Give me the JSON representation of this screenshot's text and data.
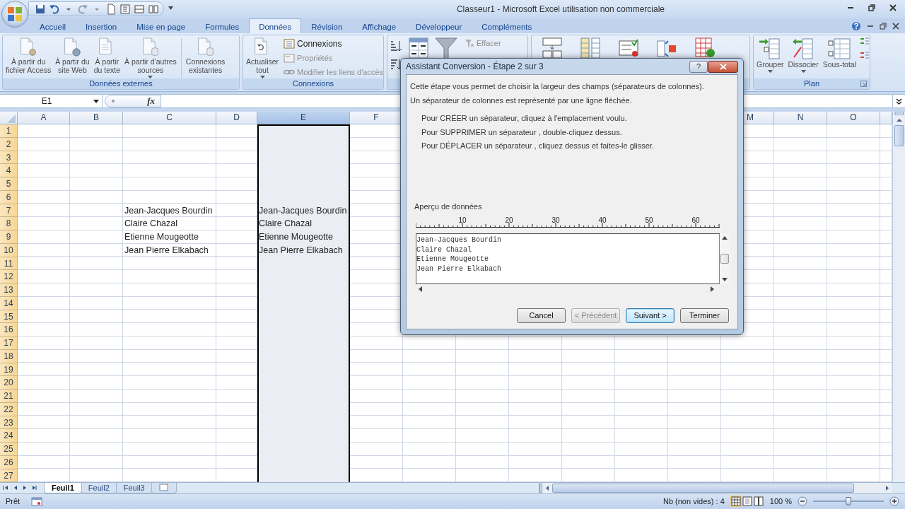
{
  "title_bar": {
    "title": "Classeur1 - Microsoft Excel utilisation non commerciale"
  },
  "ribbon": {
    "tabs": [
      {
        "label": "Accueil",
        "selected": false
      },
      {
        "label": "Insertion",
        "selected": false
      },
      {
        "label": "Mise en page",
        "selected": false
      },
      {
        "label": "Formules",
        "selected": false
      },
      {
        "label": "Données",
        "selected": true
      },
      {
        "label": "Révision",
        "selected": false
      },
      {
        "label": "Affichage",
        "selected": false
      },
      {
        "label": "Développeur",
        "selected": false
      },
      {
        "label": "Compléments",
        "selected": false
      }
    ],
    "groups": [
      {
        "kind": "large_buttons",
        "label": "Données externes",
        "buttons": [
          {
            "label": "À partir du\nfichier Access",
            "dropdown": false
          },
          {
            "label": "À partir du\nsite Web",
            "dropdown": false
          },
          {
            "label": "À partir\ndu texte",
            "dropdown": false
          },
          {
            "label": "À partir d'autres\nsources",
            "dropdown": true
          },
          {
            "label": "Connexions\nexistantes",
            "dropdown": false
          }
        ]
      },
      {
        "kind": "connections",
        "label": "Connexions",
        "buttons": [
          {
            "label": "Actualiser\ntout",
            "dropdown": true,
            "disabled": false
          },
          {
            "label": "Connexions",
            "disabled": false
          },
          {
            "label": "Propriétés",
            "disabled": true
          },
          {
            "label": "Modifier les liens d'accès",
            "disabled": true
          }
        ]
      },
      {
        "kind": "sort_filter",
        "buttons": [
          {
            "label": "Effacer",
            "disabled": true
          }
        ]
      },
      {
        "kind": "data_tools"
      },
      {
        "kind": "large_buttons",
        "label": "Plan",
        "buttons": [
          {
            "label": "Grouper",
            "dropdown": true
          },
          {
            "label": "Dissocier",
            "dropdown": true
          },
          {
            "label": "Sous-total",
            "dropdown": false
          }
        ]
      }
    ]
  },
  "formula_bar": {
    "name_box": "E1",
    "function_label": "fx"
  },
  "sheet": {
    "columns_left": [
      {
        "label": "A",
        "selected": false
      },
      {
        "label": "B",
        "selected": false
      },
      {
        "label": "C",
        "selected": false
      },
      {
        "label": "D",
        "selected": false
      },
      {
        "label": "E",
        "selected": true
      },
      {
        "label": "F",
        "selected": false
      }
    ],
    "columns_right": [
      {
        "label": "M",
        "selected": false
      },
      {
        "label": "N",
        "selected": false
      },
      {
        "label": "O",
        "selected": false
      }
    ],
    "rows": [
      {
        "label": "1"
      },
      {
        "label": "2"
      },
      {
        "label": "3"
      },
      {
        "label": "4"
      },
      {
        "label": "5"
      },
      {
        "label": "6"
      },
      {
        "label": "7",
        "cells": {
          "c": "Jean-Jacques Bourdin",
          "e": "Jean-Jacques Bourdin"
        }
      },
      {
        "label": "8",
        "cells": {
          "c": "Claire Chazal",
          "e": "Claire Chazal"
        }
      },
      {
        "label": "9",
        "cells": {
          "c": "Etienne Mougeotte",
          "e": "Etienne Mougeotte"
        }
      },
      {
        "label": "10",
        "cells": {
          "c": "Jean Pierre Elkabach",
          "e": "Jean Pierre Elkabach"
        }
      },
      {
        "label": "11"
      },
      {
        "label": "12"
      },
      {
        "label": "13"
      },
      {
        "label": "14"
      },
      {
        "label": "15"
      },
      {
        "label": "16"
      },
      {
        "label": "17"
      },
      {
        "label": "18"
      },
      {
        "label": "19"
      },
      {
        "label": "20"
      },
      {
        "label": "21"
      },
      {
        "label": "22"
      },
      {
        "label": "23"
      },
      {
        "label": "24"
      },
      {
        "label": "25"
      },
      {
        "label": "26"
      },
      {
        "label": "27"
      }
    ]
  },
  "sheet_tabs": [
    {
      "label": "Feuil1",
      "selected": true
    },
    {
      "label": "Feuil2",
      "selected": false
    },
    {
      "label": "Feuil3",
      "selected": false
    }
  ],
  "status_bar": {
    "mode": "Prêt",
    "count": "Nb (non vides) : 4",
    "zoom": "100 %",
    "zoom_slider": {
      "level": 0.5
    }
  },
  "dialog": {
    "title": "Assistant Conversion - Étape 2 sur 3",
    "help": "?",
    "intro": [
      "Cette étape vous permet de choisir la largeur des champs (séparateurs de colonnes).",
      "Un séparateur de colonnes est représenté par une ligne fléchée."
    ],
    "instructions": [
      "Pour CRÉER un séparateur, cliquez à l'emplacement voulu.",
      "Pour SUPPRIMER un séparateur , double-cliquez dessus.",
      "Pour DÉPLACER un séparateur , cliquez dessus et faites-le glisser."
    ],
    "preview_label": "Aperçu de données",
    "ruler_labels": [
      "10",
      "20",
      "30",
      "40",
      "50",
      "60"
    ],
    "preview_lines": [
      "Jean-Jacques Bourdin",
      "Claire Chazal",
      "Etienne Mougeotte",
      "Jean Pierre Elkabach"
    ],
    "buttons": [
      {
        "label": "Cancel",
        "disabled": false,
        "focused": false
      },
      {
        "label": "< Précédent",
        "disabled": true,
        "focused": false
      },
      {
        "label": "Suivant >",
        "disabled": false,
        "focused": true
      },
      {
        "label": "Terminer",
        "disabled": false,
        "focused": false
      }
    ]
  }
}
